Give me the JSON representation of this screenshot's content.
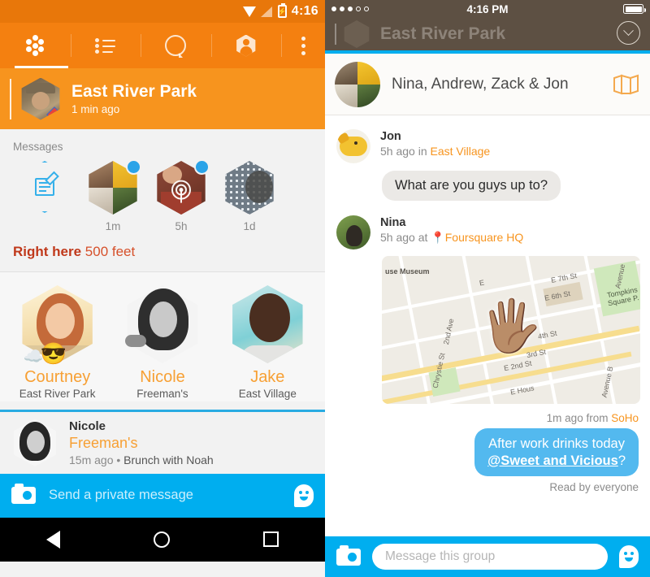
{
  "android": {
    "statusbar": {
      "time": "4:16",
      "wifi_icon": "wifi-icon",
      "signal_icon": "signal-icon",
      "battery_icon": "battery-charging-icon"
    },
    "tabs": [
      {
        "name": "swarm-logo",
        "icon": "swarm-dots-icon",
        "active": true
      },
      {
        "name": "list",
        "icon": "list-icon",
        "active": false
      },
      {
        "name": "search",
        "icon": "search-bubble-icon",
        "active": false
      },
      {
        "name": "profile",
        "icon": "profile-icon",
        "active": false
      }
    ],
    "overflow_icon": "overflow-menu-icon",
    "venue": {
      "title": "East River Park",
      "subtitle": "1 min ago"
    },
    "messages_label": "Messages",
    "compose_icon": "compose-note-icon",
    "message_avatars": [
      {
        "time": "1m",
        "badge": true,
        "radar": false
      },
      {
        "time": "5h",
        "badge": true,
        "radar": true
      },
      {
        "time": "1d",
        "badge": false,
        "radar": false
      }
    ],
    "right_here": {
      "bold": "Right here",
      "light": "500 feet"
    },
    "friends": [
      {
        "name": "Courtney",
        "place": "East River Park",
        "emoji": [
          "☁️",
          "😎"
        ]
      },
      {
        "name": "Nicole",
        "place": "Freeman's",
        "emoji": []
      },
      {
        "name": "Jake",
        "place": "East Village",
        "emoji": []
      }
    ],
    "activity": {
      "name": "Nicole",
      "place": "Freeman's",
      "time": "15m ago",
      "separator": "•",
      "detail": "Brunch with Noah"
    },
    "composer": {
      "camera_icon": "camera-icon",
      "placeholder": "Send a private message",
      "sticker_icon": "sticker-face-icon"
    },
    "navbar": {
      "back_icon": "back-triangle-icon",
      "home_icon": "home-circle-icon",
      "recents_icon": "recents-square-icon"
    }
  },
  "ios": {
    "statusbar": {
      "time": "4:16 PM",
      "signal_dots_filled": 3,
      "signal_dots_total": 5,
      "battery_icon": "battery-full-icon"
    },
    "behind_title": "East River Park",
    "collapse_icon": "chevron-down-circle-icon",
    "group": {
      "title": "Nina, Andrew, Zack & Jon",
      "map_icon": "folded-map-icon"
    },
    "messages": [
      {
        "author": "Jon",
        "time": "5h ago",
        "preposition": "in",
        "location": "East Village",
        "location_pin": false,
        "text": "What are you guys up to?",
        "side": "in"
      },
      {
        "author": "Nina",
        "time": "5h ago",
        "preposition": "at",
        "location": "Foursquare HQ",
        "location_pin": true,
        "attachment": "map",
        "side": "in"
      },
      {
        "meta": "1m ago from",
        "location": "SoHo",
        "text_line1": "After work drinks today",
        "text_mention": "@Sweet and Vicious",
        "text_suffix": "?",
        "receipt": "Read by everyone",
        "side": "out"
      }
    ],
    "map_labels": [
      "use Museum",
      "E",
      "E 7th St",
      "E 6th St",
      "Tompkins Square P.",
      "2nd Ave",
      "Chrystie St",
      "4th St",
      "3rd St",
      "E 2nd St",
      "E Hous",
      "Avenue B",
      "Avenue"
    ],
    "map_sticker": "waving-hand-emoji",
    "composer": {
      "camera_icon": "camera-icon",
      "placeholder": "Message this group",
      "sticker_icon": "sticker-face-icon"
    }
  },
  "colors": {
    "orange_dark": "#e8770a",
    "orange": "#f48010",
    "orange_light": "#f7941e",
    "orange_text": "#f7a034",
    "blue": "#00aeef",
    "blue_bubble": "#53b9ef",
    "red": "#c0391b",
    "ios_dim": "#5d5043"
  }
}
